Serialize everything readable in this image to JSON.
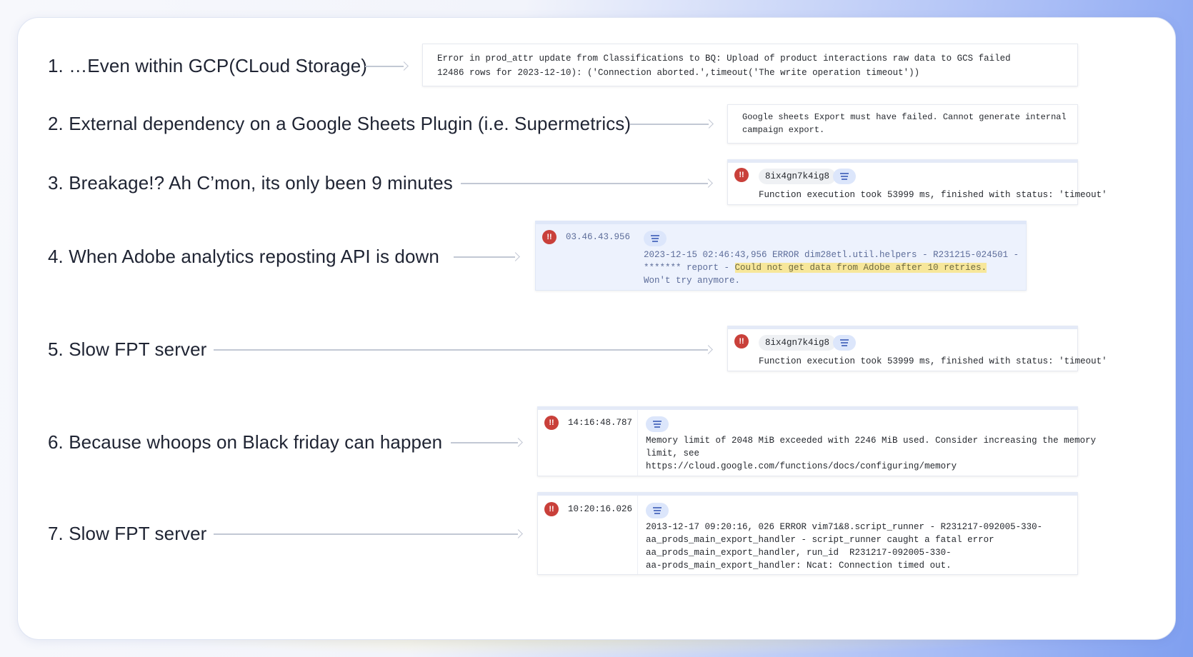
{
  "items": [
    {
      "label": "1. …Even within GCP(CLoud Storage)"
    },
    {
      "label": "2. External dependency on a Google Sheets Plugin (i.e. Supermetrics)"
    },
    {
      "label": "3. Breakage!? Ah C’mon, its only been 9 minutes"
    },
    {
      "label": "4. When Adobe analytics reposting API is down"
    },
    {
      "label": "5. Slow FPT server"
    },
    {
      "label": "6. Because whoops on Black friday can happen"
    },
    {
      "label": "7. Slow FPT server"
    }
  ],
  "logs": {
    "log1": {
      "line1": "Error in prod_attr update from Classifications to BQ: Upload of product interactions raw data to GCS failed",
      "line2": "12486 rows for 2023-12-10): ('Connection aborted.',timeout('The write operation timeout'))"
    },
    "log2": {
      "line1": "Google sheets Export must have failed. Cannot generate internal",
      "line2": "campaign export."
    },
    "log3": {
      "icon": "error-icon",
      "icon_glyph": "!!",
      "chip": "8ix4gn7k4ig8",
      "message": "Function execution took 53999 ms, finished with status: 'timeout'"
    },
    "log4": {
      "icon_glyph": "!!",
      "timestamp": "03.46.43.956",
      "line1": "2023-12-15 02:46:43,956 ERROR dim28etl.util.helpers - R231215-024501 -",
      "line2_prefix": "******* report - ",
      "line2_highlight": "Could not get data from Adobe after 10 retries.",
      "line3": "Won't try anymore."
    },
    "log5": {
      "icon_glyph": "!!",
      "chip": "8ix4gn7k4ig8",
      "message": "Function execution took 53999 ms, finished with status: 'timeout'"
    },
    "log6": {
      "icon_glyph": "!!",
      "timestamp": "14:16:48.787",
      "line1": "Memory limit of 2048 MiB exceeded with 2246 MiB used. Consider increasing the memory",
      "line2": "limit, see",
      "line3": "https://cloud.google.com/functions/docs/configuring/memory"
    },
    "log7": {
      "icon_glyph": "!!",
      "timestamp": "10:20:16.026",
      "line1": "2013-12-17 09:20:16, 026 ERROR vim71&8.script_runner - R231217-092005-330-",
      "line2": "aa_prods_main_export_handler - script_runner caught a fatal error",
      "line3": "aa_prods_main_export_handler, run_id  R231217-092005-330-",
      "line4": "aa-prods_main_export_handler: Ncat: Connection timed out."
    }
  },
  "colors": {
    "error_icon": "#c9403a",
    "highlight": "#f7e79b",
    "filter_chip": "#dce6fb",
    "text": "#1f2433"
  }
}
